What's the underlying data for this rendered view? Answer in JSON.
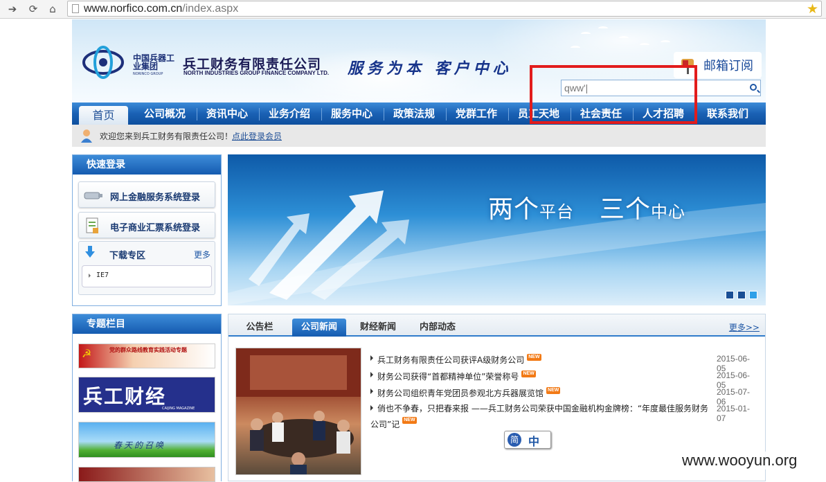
{
  "browser": {
    "url_host": "www.norfico.com.cn",
    "url_path": "/index.aspx",
    "back_icon": "arrow-right-icon",
    "reload_icon": "reload-icon",
    "home_icon": "home-icon"
  },
  "header": {
    "logo_cn": "中国兵器工业集团",
    "logo_en": "NORINCO GROUP",
    "company_name": "兵工财务有限责任公司",
    "company_name_en": "NORTH INDUSTRIES GROUP FINANCE COMPANY LTD.",
    "slogan": "服务为本 客户中心",
    "mail_subscribe": "邮箱订阅",
    "search_value": "qww'|"
  },
  "nav": {
    "items": [
      "首页",
      "公司概况",
      "资讯中心",
      "业务介绍",
      "服务中心",
      "政策法规",
      "党群工作",
      "员工天地",
      "社会责任",
      "人才招聘",
      "联系我们"
    ]
  },
  "welcome": {
    "text": "欢迎您来到兵工财务有限责任公司！",
    "login_link": "点此登录会员"
  },
  "quick_login": {
    "title": "快速登录",
    "btn1": "网上金融服务系统登录",
    "btn2": "电子商业汇票系统登录",
    "download_title": "下载专区",
    "download_more": "更多",
    "download_item": "IE7"
  },
  "special": {
    "title": "专题栏目",
    "banner1": "党的群众路线教育实践活动专题",
    "banner2": "兵工财经",
    "banner2_sub": "CAIJING MAGAZINE",
    "banner3": "春天的召唤"
  },
  "banner": {
    "text_a": "两个",
    "text_b": "平台",
    "text_c": "三个",
    "text_d": "中心"
  },
  "news": {
    "tabs": [
      "公告栏",
      "公司新闻",
      "财经新闻",
      "内部动态"
    ],
    "more": "更多>>",
    "new_tag": "NEW",
    "items": [
      {
        "title": "兵工财务有限责任公司获评A级财务公司",
        "date": "2015-06-05"
      },
      {
        "title": "财务公司获得“首都精神单位”荣誉称号",
        "date": "2015-06-05"
      },
      {
        "title": "财务公司组织青年党团员参观北方兵器展览馆",
        "date": "2015-07-06"
      },
      {
        "title": "俏也不争春，只把春来报 ——兵工财务公司荣获中国金融机构金牌榜：“年度最佳服务财务",
        "title_cont": "公司”记",
        "date": "2015-01-07"
      }
    ]
  },
  "ime": {
    "a": "简",
    "b": "中"
  },
  "watermark": "www.wooyun.org",
  "colors": {
    "nav_blue": "#1a61b4",
    "highlight_red": "#e21c1c",
    "new_orange": "#f27a16"
  }
}
